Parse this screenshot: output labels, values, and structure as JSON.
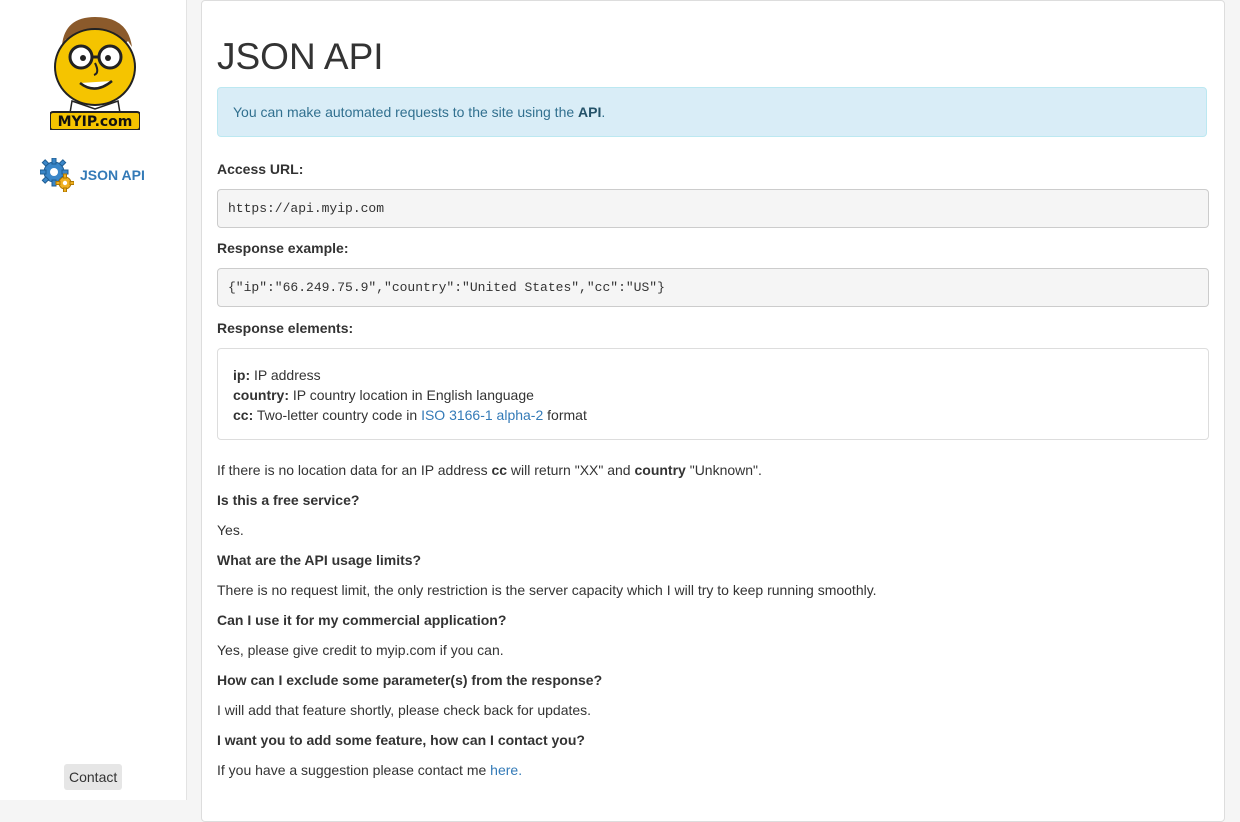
{
  "sidebar": {
    "logo_text": "MYIP.com",
    "nav_label": "JSON API",
    "contact_label": "Contact"
  },
  "main": {
    "title": "JSON API",
    "alert": {
      "text": "You can make automated requests to the site using the",
      "link": "API",
      "suffix": "."
    },
    "access_url_heading": "Access URL:",
    "access_url": "https://api.myip.com",
    "response_example_heading": "Response example:",
    "response_example": "{\"ip\":\"66.249.75.9\",\"country\":\"United States\",\"cc\":\"US\"}",
    "response_elements_heading": "Response elements:",
    "elements": {
      "ip_key": "ip:",
      "ip_desc": " IP address",
      "country_key": "country:",
      "country_desc": " IP country location in English language",
      "cc_key": "cc:",
      "cc_desc": " Two-letter country code in ",
      "cc_link": "ISO 3166-1 alpha-2",
      "cc_suffix": " format"
    },
    "no_location": {
      "t1": "If there is no location data for an IP address ",
      "b1": "cc",
      "t2": " will return \"XX\" and ",
      "b2": "country",
      "t3": " \"Unknown\"."
    },
    "faq": [
      {
        "q": "Is this a free service?",
        "a": "Yes."
      },
      {
        "q": "What are the API usage limits?",
        "a": "There is no request limit, the only restriction is the server capacity which I will try to keep running smoothly."
      },
      {
        "q": "Can I use it for my commercial application?",
        "a": "Yes, please give credit to myip.com if you can."
      },
      {
        "q": "How can I exclude some parameter(s) from the response?",
        "a": "I will add that feature shortly, please check back for updates."
      },
      {
        "q": "I want you to add some feature, how can I contact you?",
        "a": "If you have a suggestion please contact me ",
        "link": "here."
      }
    ]
  }
}
